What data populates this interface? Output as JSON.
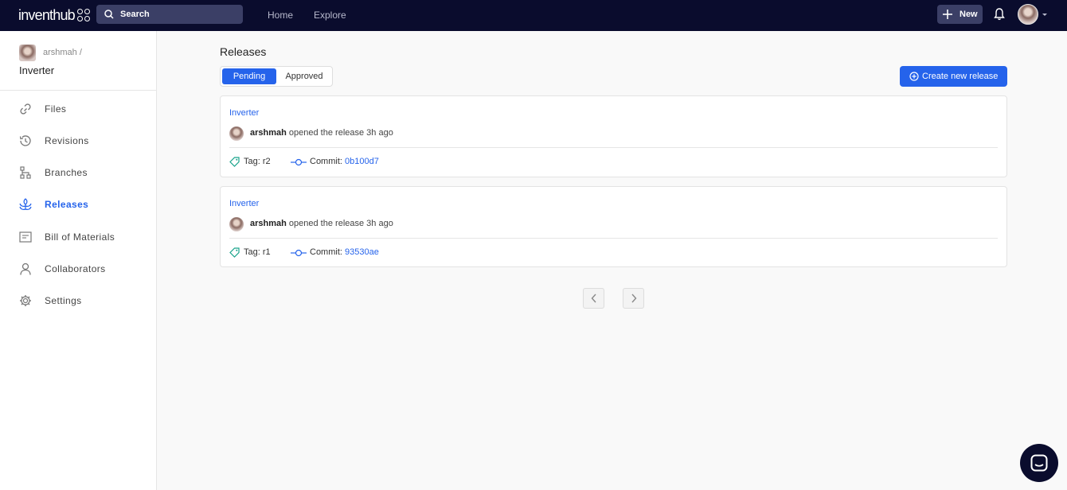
{
  "topbar": {
    "logo_text": "inventhub",
    "search_label": "Search",
    "nav": [
      "Home",
      "Explore"
    ],
    "new_label": "New"
  },
  "sidebar": {
    "owner": "arshmah /",
    "repo": "Inverter",
    "items": [
      {
        "label": "Files",
        "icon": "link-icon"
      },
      {
        "label": "Revisions",
        "icon": "history-icon"
      },
      {
        "label": "Branches",
        "icon": "branch-icon"
      },
      {
        "label": "Releases",
        "icon": "releases-icon",
        "active": true
      },
      {
        "label": "Bill of Materials",
        "icon": "bom-icon"
      },
      {
        "label": "Collaborators",
        "icon": "user-icon"
      },
      {
        "label": "Settings",
        "icon": "gear-icon"
      }
    ]
  },
  "main": {
    "title": "Releases",
    "tabs": [
      "Pending",
      "Approved"
    ],
    "active_tab": "Pending",
    "create_label": "Create new release",
    "releases": [
      {
        "title": "Inverter",
        "user": "arshmah",
        "action": "opened the release 3h ago",
        "tag_label": "Tag:",
        "tag": "r2",
        "commit_label": "Commit:",
        "commit": "0b100d7"
      },
      {
        "title": "Inverter",
        "user": "arshmah",
        "action": "opened the release 3h ago",
        "tag_label": "Tag:",
        "tag": "r1",
        "commit_label": "Commit:",
        "commit": "93530ae"
      }
    ]
  },
  "colors": {
    "topbar": "#0a0c2d",
    "accent": "#2563eb",
    "background": "#f9f9f9"
  }
}
